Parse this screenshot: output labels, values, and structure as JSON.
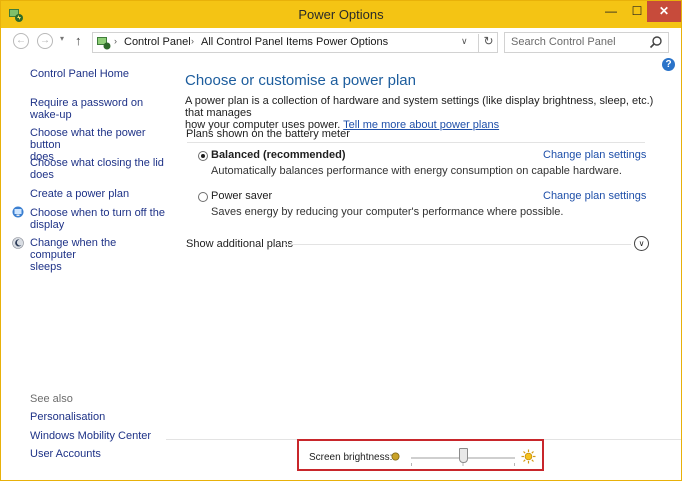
{
  "window": {
    "title": "Power Options",
    "minimize": "—",
    "maximize": "☐",
    "close": "✕"
  },
  "nav": {
    "back": "←",
    "forward": "→",
    "recent": "▾",
    "up": "↑",
    "breadcrumbs": [
      "Control Panel",
      "All Control Panel Items",
      "Power Options"
    ],
    "separator": "›",
    "dropdown": "∨",
    "refresh": "↻",
    "search_placeholder": "Search Control Panel"
  },
  "help": "?",
  "sidebar": {
    "home": "Control Panel Home",
    "items": [
      {
        "line1": "Require a password on",
        "line2": "wake-up"
      },
      {
        "line1": "Choose what the power button",
        "line2": "does"
      },
      {
        "line1": "Choose what closing the lid",
        "line2": "does"
      },
      {
        "line1": "Create a power plan",
        "line2": ""
      },
      {
        "line1": "Choose when to turn off the",
        "line2": "display",
        "icon": "display-icon"
      },
      {
        "line1": "Change when the computer",
        "line2": "sleeps",
        "icon": "moon-icon"
      }
    ],
    "see_also": "See also",
    "see_also_items": [
      "Personalisation",
      "Windows Mobility Center",
      "User Accounts"
    ]
  },
  "main": {
    "title": "Choose or customise a power plan",
    "description_line1": "A power plan is a collection of hardware and system settings (like display brightness, sleep, etc.) that manages",
    "description_line2": "how your computer uses power.",
    "description_link": "Tell me more about power plans",
    "group_label": "Plans shown on the battery meter",
    "plans": [
      {
        "name": "Balanced (recommended)",
        "description": "Automatically balances performance with energy consumption on capable hardware.",
        "link": "Change plan settings",
        "selected": true
      },
      {
        "name": "Power saver",
        "description": "Saves energy by reducing your computer's performance where possible.",
        "link": "Change plan settings",
        "selected": false
      }
    ],
    "show_additional": "Show additional plans",
    "expand_icon": "∨"
  },
  "brightness": {
    "label": "Screen brightness:",
    "level": 0.5
  },
  "colors": {
    "titlebar": "#f4c414",
    "link": "#1e3287",
    "title_text": "#1d5d9d",
    "highlight_box": "#c8262b",
    "close_button": "#c74b3b"
  }
}
